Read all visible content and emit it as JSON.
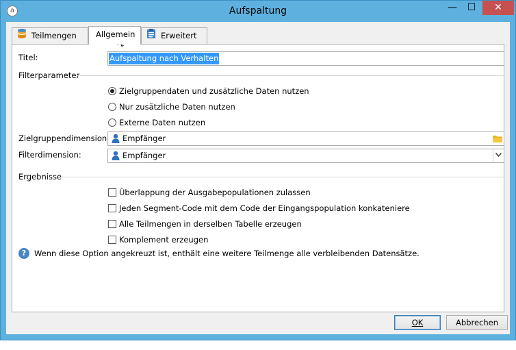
{
  "window": {
    "title": "Aufspaltung",
    "close_glyph": "✕",
    "min_glyph": "—",
    "max_glyph": "☐",
    "app_icon_glyph": "a"
  },
  "tabs": [
    {
      "label": "Teilmengen",
      "icon": "database-icon"
    },
    {
      "label": "Allgemein",
      "icon": "none"
    },
    {
      "label": "Erweitert",
      "icon": "clipboard-icon"
    }
  ],
  "form": {
    "title_label": "Titel:",
    "title_value": "Aufspaltung nach Verhalten",
    "filter_group": "Filterparameter",
    "radio_options": [
      {
        "label": "Zielgruppendaten und zusätzliche Daten nutzen",
        "selected": true
      },
      {
        "label": "Nur zusätzliche Daten nutzen",
        "selected": false
      },
      {
        "label": "Externe Daten nutzen",
        "selected": false
      }
    ],
    "target_dim_label": "Zielgruppendimension:",
    "target_dim_value": "Empfänger",
    "filter_dim_label": "Filterdimension:",
    "filter_dim_value": "Empfänger",
    "results_group": "Ergebnisse",
    "checkboxes": [
      {
        "label": "Überlappung der Ausgabepopulationen zulassen",
        "checked": false
      },
      {
        "label": "Jeden Segment-Code mit dem Code der Eingangspopulation konkateniere",
        "checked": false
      },
      {
        "label": "Alle Teilmengen in derselben Tabelle erzeugen",
        "checked": false
      },
      {
        "label": "Komplement erzeugen",
        "checked": false
      }
    ],
    "help_text": "Wenn diese Option angekreuzt ist, enthält eine weitere Teilmenge alle verbleibenden Datensätze.",
    "help_glyph": "?"
  },
  "buttons": {
    "ok": "OK",
    "cancel": "Abbrechen"
  },
  "colors": {
    "accent": "#5eb1de",
    "selection": "#3399ff",
    "close": "#c75050"
  }
}
